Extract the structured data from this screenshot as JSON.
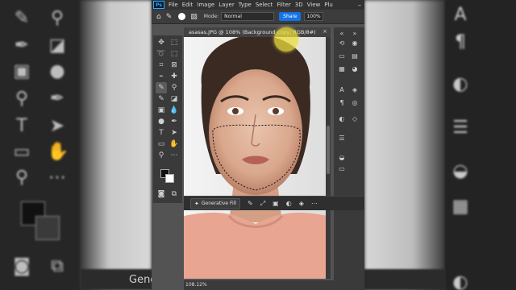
{
  "menu": {
    "logo": "Ps",
    "items": [
      "File",
      "Edit",
      "Image",
      "Layer",
      "Type",
      "Select",
      "Filter",
      "3D",
      "View",
      "Plu"
    ],
    "minimize": "–"
  },
  "options_bar": {
    "mode_label": "Mode:",
    "mode_value": "Normal",
    "share_label": "Share",
    "zoom_value": "100%"
  },
  "document": {
    "tab_title": "asasas.JPG @ 108% (Background copy, RGB/8#)",
    "close": "×"
  },
  "context_bar": {
    "generative_fill_label": "Generative Fill",
    "icons": [
      "brush-icon",
      "transform-icon",
      "mask-icon",
      "invert-icon",
      "more-icon"
    ]
  },
  "status": {
    "zoom": "108.12%"
  },
  "background": {
    "bottom_label": "Gene"
  },
  "colors": {
    "accent": "#1473e6",
    "panel": "#3a3a3a",
    "canvas_bg": "#535353",
    "cursor_highlight": "#ebdc3c",
    "shirt": "#e8a692"
  }
}
